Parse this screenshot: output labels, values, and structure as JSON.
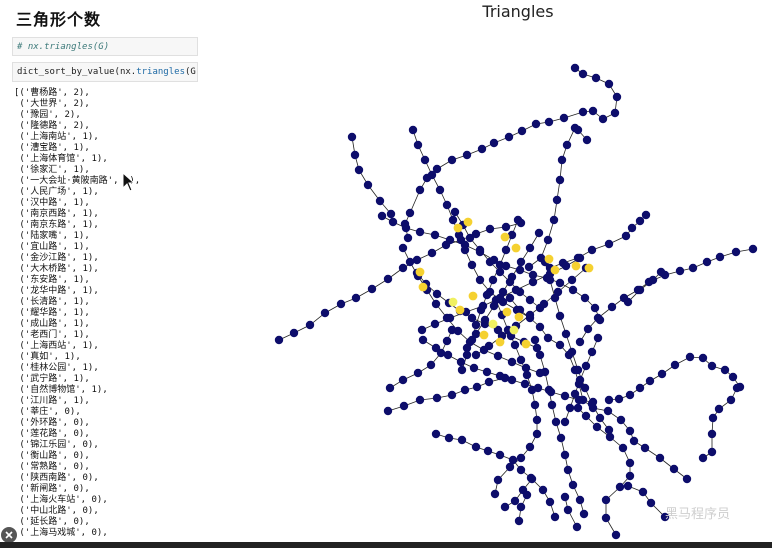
{
  "notebook": {
    "heading": "三角形个数",
    "cell1_code": "# nx.triangles(G)",
    "cell2_prefix": "dict_sort_by_value(nx.",
    "cell2_keyword": "triangles",
    "cell2_suffix": "(G))",
    "output_lines": [
      "[('曹杨路', 2),",
      " ('大世界', 2),",
      " ('豫园', 2),",
      " ('隆德路', 2),",
      " ('上海南站', 1),",
      " ('漕宝路', 1),",
      " ('上海体育馆', 1),",
      " ('徐家汇', 1),",
      " ('一大会址·黄陂南路', 1),",
      " ('人民广场', 1),",
      " ('汉中路', 1),",
      " ('南京西路', 1),",
      " ('南京东路', 1),",
      " ('陆家嘴', 1),",
      " ('宜山路', 1),",
      " ('金沙江路', 1),",
      " ('大木桥路', 1),",
      " ('东安路', 1),",
      " ('龙华中路', 1),",
      " ('长清路', 1),",
      " ('耀华路', 1),",
      " ('成山路', 1),",
      " ('老西门', 1),",
      " ('上海西站', 1),",
      " ('真如', 1),",
      " ('桂林公园', 1),",
      " ('武宁路', 1),",
      " ('自然博物馆', 1),",
      " ('江川路', 1),",
      " ('莘庄', 0),",
      " ('外环路', 0),",
      " ('莲花路', 0),",
      " ('锦江乐园', 0),",
      " ('衡山路', 0),",
      " ('常熟路', 0),",
      " ('陕西南路', 0),",
      " ('新闸路', 0),",
      " ('上海火车站', 0),",
      " ('中山北路', 0),",
      " ('延长路', 0),",
      " ('上海马戏城', 0),"
    ]
  },
  "plot": {
    "title": "Triangles",
    "node_color_low": "#0d0d6b",
    "node_color_mid": "#f5d130",
    "node_color_high": "#f0f060"
  },
  "watermark": "黑马程序员",
  "icons": {
    "cursor": "mouse-pointer-icon",
    "corner": "close-circle-icon"
  }
}
